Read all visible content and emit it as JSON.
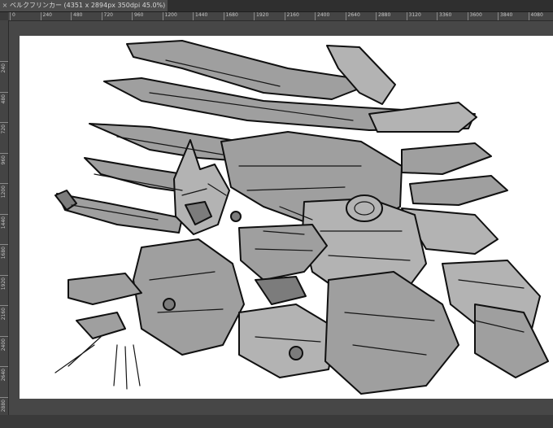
{
  "document_tab": {
    "title": "ベルクフリンカー (4351 x 2894px 350dpi 45.0%)",
    "close_glyph": "×"
  },
  "ruler": {
    "horizontal_ticks": [
      "0",
      "240",
      "480",
      "720",
      "960",
      "1200",
      "1440",
      "1680",
      "1920",
      "2160",
      "2400",
      "2640",
      "2880",
      "3120",
      "3360",
      "3600",
      "3840",
      "4080"
    ],
    "vertical_ticks": [
      "240",
      "480",
      "720",
      "960",
      "1200",
      "1440",
      "1680",
      "1920",
      "2160",
      "2400",
      "2640",
      "2880"
    ]
  },
  "canvas": {
    "paper_color": "#ffffff",
    "background_color": "#474747",
    "artwork": "line-art-mecha-icon"
  }
}
